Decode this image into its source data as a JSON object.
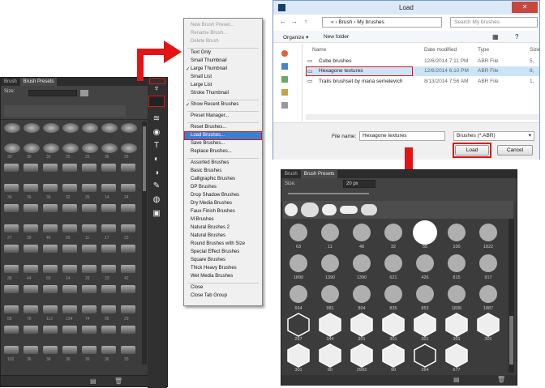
{
  "left_panel": {
    "tabs": [
      "Brush",
      "Brush Presets"
    ],
    "size_label": "Size:",
    "brush_size_numbers": [
      "30",
      "30",
      "30",
      "25",
      "25",
      "36",
      "25",
      "36",
      "36",
      "36",
      "32",
      "25",
      "14",
      "24",
      "27",
      "39",
      "46",
      "59",
      "11",
      "17",
      "23",
      "36",
      "44",
      "60",
      "14",
      "26",
      "33",
      "42",
      "55",
      "70",
      "112",
      "134",
      "74",
      "95",
      "29",
      "192",
      "36",
      "36",
      "36",
      "36",
      "36",
      "33",
      "63",
      "66",
      "39",
      "63",
      "11",
      "48",
      "32",
      "55",
      "100",
      "75",
      "45",
      "1000",
      "25",
      "50",
      "25"
    ]
  },
  "menu": {
    "items": [
      {
        "label": "New Brush Preset...",
        "disabled": true
      },
      {
        "label": "Rename Brush...",
        "disabled": true
      },
      {
        "label": "Delete Brush",
        "disabled": true
      },
      {
        "label": "Text Only"
      },
      {
        "label": "Small Thumbnail"
      },
      {
        "label": "Large Thumbnail",
        "checked": true
      },
      {
        "label": "Small List"
      },
      {
        "label": "Large List"
      },
      {
        "label": "Stroke Thumbnail"
      },
      {
        "label": "Show Recent Brushes",
        "checked": true
      },
      {
        "label": "Preset Manager..."
      },
      {
        "label": "Reset Brushes..."
      },
      {
        "label": "Load Brushes...",
        "highlighted": true
      },
      {
        "label": "Save Brushes..."
      },
      {
        "label": "Replace Brushes..."
      },
      {
        "label": "Assorted Brushes"
      },
      {
        "label": "Basic Brushes"
      },
      {
        "label": "Calligraphic Brushes"
      },
      {
        "label": "DP Brushes"
      },
      {
        "label": "Drop Shadow Brushes"
      },
      {
        "label": "Dry Media Brushes"
      },
      {
        "label": "Faux Finish Brushes"
      },
      {
        "label": "M Brushes"
      },
      {
        "label": "Natural Brushes 2"
      },
      {
        "label": "Natural Brushes"
      },
      {
        "label": "Round Brushes with Size"
      },
      {
        "label": "Special Effect Brushes"
      },
      {
        "label": "Square Brushes"
      },
      {
        "label": "Thick Heavy Brushes"
      },
      {
        "label": "Wet Media Brushes"
      },
      {
        "label": "Close"
      },
      {
        "label": "Close Tab Group"
      }
    ]
  },
  "dialog": {
    "title": "Load",
    "path": [
      "«",
      "Brush",
      "My brushes"
    ],
    "search_placeholder": "Search My brushes",
    "organize": "Organize ▾",
    "new_folder": "New folder",
    "columns": {
      "name": "Name",
      "date": "Date modified",
      "type": "Type",
      "size": "Size"
    },
    "files": [
      {
        "name": "Cube brushes",
        "date": "12/6/2014 7:11 PM",
        "type": "ABR File",
        "size": "5,"
      },
      {
        "name": "Hexagone textures",
        "date": "12/6/2014 6:10 PM",
        "type": "ABR File",
        "size": "8,",
        "selected": true
      },
      {
        "name": "Trails brushset by maria semelevich",
        "date": "8/13/2014 7:56 AM",
        "type": "ABR File",
        "size": "1,"
      }
    ],
    "file_name_label": "File name:",
    "file_name_value": "Hexagone textures",
    "file_type": "Brushes (*.ABR)",
    "load": "Load",
    "cancel": "Cancel"
  },
  "right_panel": {
    "tabs": [
      "Brush",
      "Brush Presets"
    ],
    "size_label": "Size:",
    "size_value": "20 px",
    "row_labels": [
      [
        "63",
        "11",
        "48",
        "32",
        "55",
        "100",
        "1822"
      ],
      [
        "1890",
        "1390",
        "1390",
        "621",
        "426",
        "815",
        "917"
      ],
      [
        "664",
        "981",
        "804",
        "835",
        "853",
        "1836",
        "1887"
      ],
      [
        "267",
        "344",
        "301",
        "301",
        "301",
        "301",
        "301"
      ],
      [
        "301",
        "80",
        "2993",
        "90",
        "264",
        "677",
        ""
      ]
    ]
  },
  "colors": {
    "accent": "#e21414",
    "ps_bg": "#3c3c3c",
    "select": "#cce4f7"
  }
}
